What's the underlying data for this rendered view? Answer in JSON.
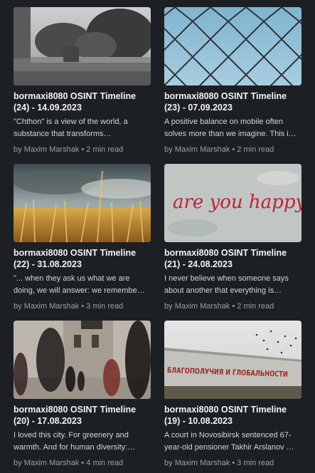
{
  "posts": [
    {
      "title": "bormaxi8080 OSINT Timeline (24) - 14.09.2023",
      "excerpt": "\"Chthon\" is a view of the world, a substance that transforms…",
      "author": "Maxim Marshak",
      "read_time": "2 min read",
      "image": "bw-rooftop-trees"
    },
    {
      "title": "bormaxi8080 OSINT Timeline (23) - 07.09.2023",
      "excerpt": "A positive balance on mobile often solves more than we imagine. This i…",
      "author": "Maxim Marshak",
      "read_time": "2 min read",
      "image": "chainlink-fence-sky"
    },
    {
      "title": "bormaxi8080 OSINT Timeline (22) - 31.08.2023",
      "excerpt": "\"... when they ask us what we are doing, we will answer: we remembe…",
      "author": "Maxim Marshak",
      "read_time": "3 min read",
      "image": "wheat-field-clouds"
    },
    {
      "title": "bormaxi8080 OSINT Timeline (21) - 24.08.2023",
      "excerpt": "I never believe when someone says about another that everything is…",
      "author": "Maxim Marshak",
      "read_time": "2 min read",
      "image": "are-you-happy-graffiti",
      "image_text": "are you happy?"
    },
    {
      "title": "bormaxi8080 OSINT Timeline (20) - 17.08.2023",
      "excerpt": "I loved this city. For greenery and warmth. And for human diversity:…",
      "author": "Maxim Marshak",
      "read_time": "4 min read",
      "image": "blurred-street-people"
    },
    {
      "title": "bormaxi8080 OSINT Timeline (19) - 10.08.2023",
      "excerpt": "A court in Novosibirsk sentenced 67-year-old pensioner Takhir Arslanov …",
      "author": "Maxim Marshak",
      "read_time": "3 min read",
      "image": "wall-slogan-birds",
      "image_text": "БЛАГОПОЛУЧИЯ И ГЛОБАЛЬНОСТИ"
    }
  ],
  "byline_prefix": "by",
  "separator": "•"
}
